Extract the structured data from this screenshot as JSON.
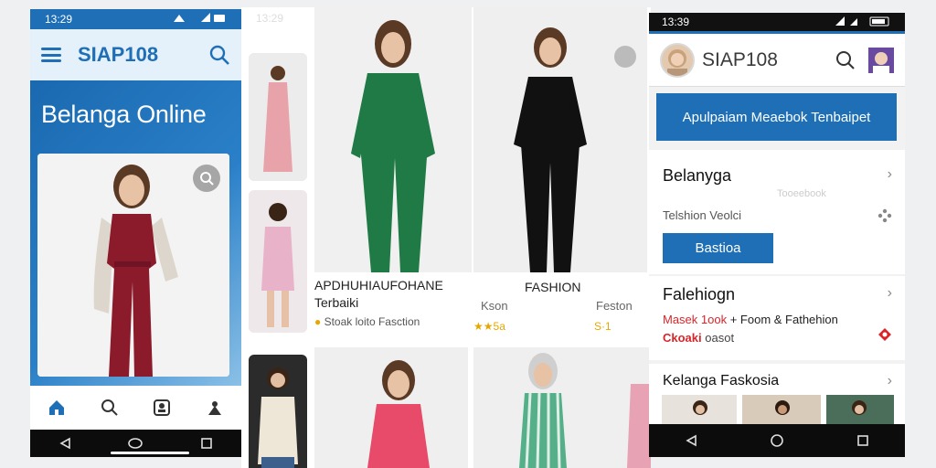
{
  "screen1": {
    "status": {
      "time": "13:29"
    },
    "appbar": {
      "title": "SIAP108"
    },
    "hero": {
      "title": "Belanga Online"
    },
    "nav": {
      "items": [
        "home-icon",
        "search-icon",
        "account-icon",
        "person-icon"
      ]
    },
    "colors": {
      "primary": "#1e6fb6",
      "dress": "#8b1a2b"
    }
  },
  "screen2": {
    "status": {
      "time": "13:29"
    },
    "captions": {
      "c1_line1": "APDHUHIAUFOHANE",
      "c1_line2": "Terbaiki",
      "c1_rating": "Stoak loito Fasction",
      "c2_line1": "FASHION",
      "c2_sub_left": "Kson",
      "c2_sub_right": "Feston",
      "c2_rating_left": "★★5a",
      "c2_rating_right": "S·1"
    },
    "colors": {
      "green": "#1f7a45",
      "black": "#111111",
      "pink": "#e84a6a",
      "stripe": "#55b08a"
    }
  },
  "screen3": {
    "status": {
      "time": "13:39"
    },
    "header": {
      "title": "SIAP108"
    },
    "banner": {
      "label": "Apulpaiam Meaebok Tenbaipet"
    },
    "section1": {
      "title": "Belanyga",
      "faint": "Tooeebook",
      "sub": "Telshion Veolci",
      "button": "Bastioa"
    },
    "section2": {
      "title": "Falehiogn",
      "line1_red": "Masek 1ook",
      "line1_rest": "+ Foom & Fathehion",
      "line2_red": "Ckoaki",
      "line2_rest": "oasot"
    },
    "section3": {
      "title": "Kelanga Faskosia"
    },
    "colors": {
      "primary": "#1e6fb6",
      "accent_red": "#d9252a"
    }
  }
}
